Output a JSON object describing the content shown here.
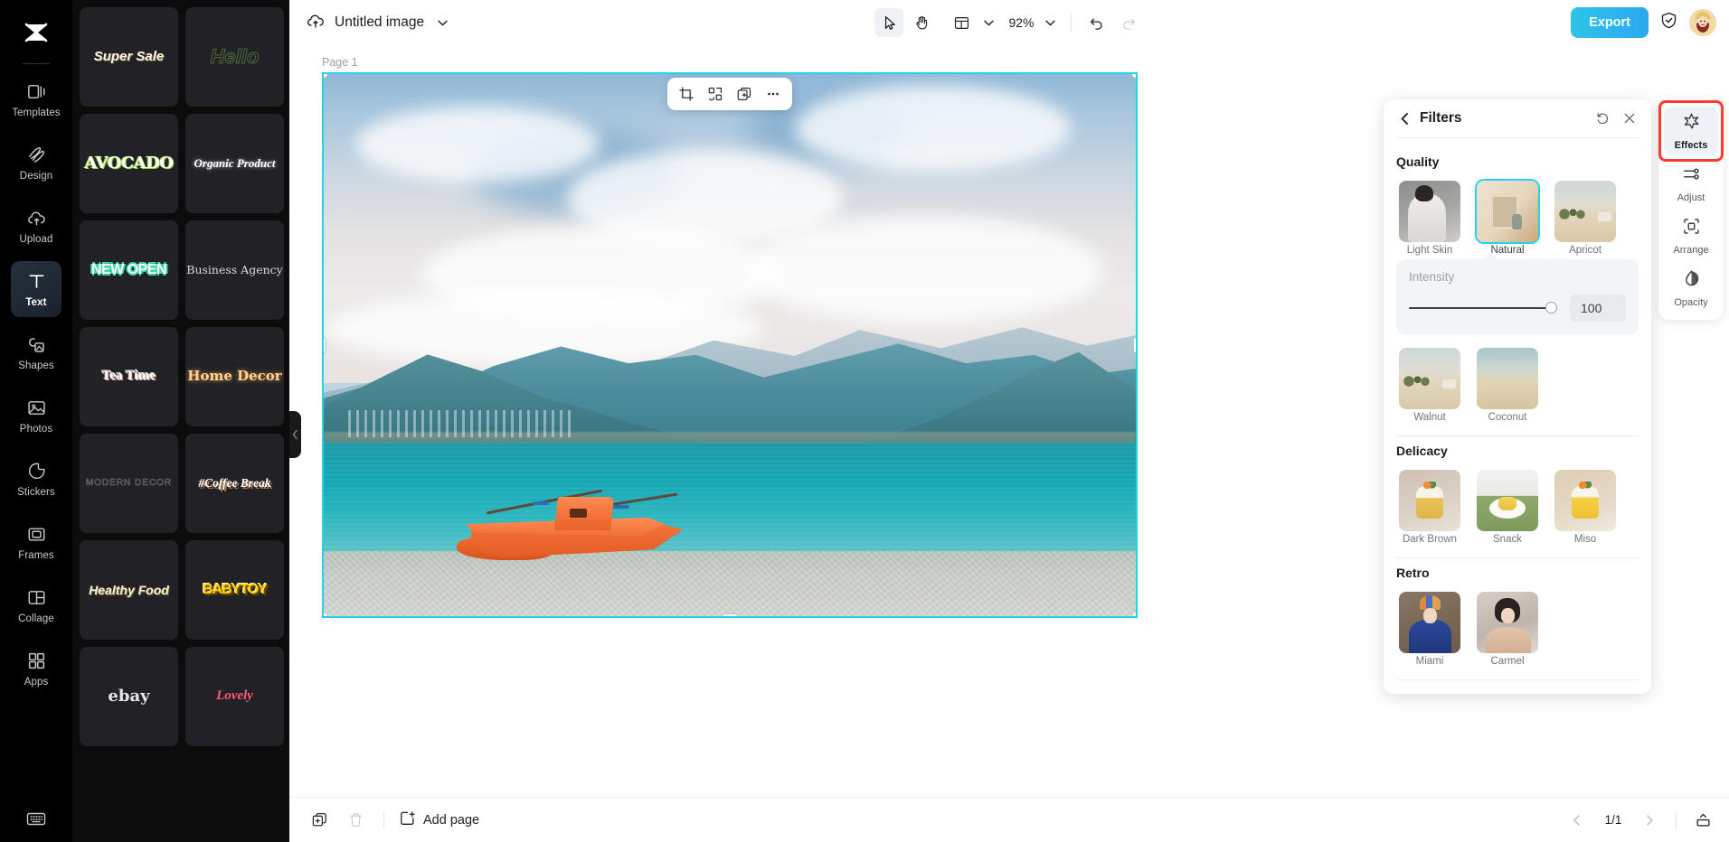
{
  "app": {
    "brand": "capcut-logo",
    "accent": "#22d3ee",
    "export_color": "#2fc4e8",
    "highlight_color": "#ff3b30"
  },
  "rail": {
    "items": [
      {
        "label": "Templates",
        "icon": "templates-icon",
        "active": false
      },
      {
        "label": "Design",
        "icon": "design-icon",
        "active": false
      },
      {
        "label": "Upload",
        "icon": "upload-icon",
        "active": false
      },
      {
        "label": "Text",
        "icon": "text-icon",
        "active": true
      },
      {
        "label": "Shapes",
        "icon": "shapes-icon",
        "active": false
      },
      {
        "label": "Photos",
        "icon": "photos-icon",
        "active": false
      },
      {
        "label": "Stickers",
        "icon": "stickers-icon",
        "active": false
      },
      {
        "label": "Frames",
        "icon": "frames-icon",
        "active": false
      },
      {
        "label": "Collage",
        "icon": "collage-icon",
        "active": false
      },
      {
        "label": "Apps",
        "icon": "apps-icon",
        "active": false
      }
    ],
    "bottom_icon": "keyboard-icon"
  },
  "templates": {
    "cards": [
      {
        "text": "Super Sale",
        "style": "t-super"
      },
      {
        "text": "Hello",
        "style": "t-hello"
      },
      {
        "text": "AVOCADO",
        "style": "t-avocado"
      },
      {
        "text": "Organic Product",
        "style": "t-organic"
      },
      {
        "text": "NEW OPEN",
        "style": "t-newopen"
      },
      {
        "text": "Business Agency",
        "style": "t-business"
      },
      {
        "text": "Tea Time",
        "style": "t-tea"
      },
      {
        "text": "Home Decor",
        "style": "t-home"
      },
      {
        "text": "MODERN DECOR",
        "style": "t-modern"
      },
      {
        "text": "#Coffee Break",
        "style": "t-coffee"
      },
      {
        "text": "Healthy Food",
        "style": "t-healthy"
      },
      {
        "text": "BABYTOY",
        "style": "t-baby"
      },
      {
        "text": "ebay",
        "style": "t-ebay"
      },
      {
        "text": "Lovely",
        "style": "t-lovely"
      }
    ]
  },
  "topbar": {
    "cloud_icon": "cloud-upload-icon",
    "title": "Untitled image",
    "title_chevron": "chevron-down-icon",
    "tools": [
      {
        "name": "select-tool",
        "icon": "cursor-arrow-icon",
        "selected": true
      },
      {
        "name": "hand-tool",
        "icon": "hand-icon",
        "selected": false
      }
    ],
    "layout_icon": "layout-panel-icon",
    "zoom": "92%",
    "undo_icon": "undo-icon",
    "redo_icon": "redo-icon",
    "export_label": "Export",
    "shield_icon": "shield-check-icon",
    "avatar": "user-avatar"
  },
  "canvas": {
    "page_label": "Page 1",
    "float_toolbar": [
      {
        "name": "crop-button",
        "icon": "crop-icon"
      },
      {
        "name": "remove-bg-button",
        "icon": "remove-background-icon"
      },
      {
        "name": "duplicate-button",
        "icon": "add-copy-icon"
      },
      {
        "name": "more-button",
        "icon": "ellipsis-icon"
      }
    ],
    "image_alt": "orange-catamaran-boat-on-lake-shore-with-mountains"
  },
  "filters": {
    "back_icon": "chevron-left-icon",
    "title": "Filters",
    "reset_icon": "reset-icon",
    "close_icon": "close-icon",
    "sections": [
      {
        "title": "Quality",
        "items": [
          {
            "label": "Light Skin",
            "thumb": "th-lightskin",
            "selected": false
          },
          {
            "label": "Natural",
            "thumb": "th-natural",
            "selected": true
          },
          {
            "label": "Apricot",
            "thumb": "th-desert",
            "selected": false
          },
          {
            "label": "Walnut",
            "thumb": "th-desert",
            "selected": false
          },
          {
            "label": "Coconut",
            "thumb": "th-desert2",
            "selected": false
          }
        ]
      },
      {
        "title": "Delicacy",
        "items": [
          {
            "label": "Dark Brown",
            "thumb": "th-cake",
            "selected": false
          },
          {
            "label": "Snack",
            "thumb": "th-snack",
            "selected": false
          },
          {
            "label": "Miso",
            "thumb": "th-miso",
            "selected": false
          }
        ]
      },
      {
        "title": "Retro",
        "items": [
          {
            "label": "Miami",
            "thumb": "th-miami",
            "selected": false
          },
          {
            "label": "Carmel",
            "thumb": "th-carmel",
            "selected": false
          }
        ]
      }
    ],
    "intensity": {
      "label": "Intensity",
      "value": "100",
      "percent": 100
    }
  },
  "right_rail": {
    "items": [
      {
        "label": "Effects",
        "icon": "sparkle-icon",
        "active": true,
        "highlighted": true
      },
      {
        "label": "Adjust",
        "icon": "sliders-icon",
        "active": false,
        "highlighted": false
      },
      {
        "label": "Arrange",
        "icon": "arrange-icon",
        "active": false,
        "highlighted": false
      },
      {
        "label": "Opacity",
        "icon": "opacity-drop-icon",
        "active": false,
        "highlighted": false
      }
    ]
  },
  "bottombar": {
    "duplicate_page_icon": "duplicate-page-icon",
    "delete_page_icon": "trash-icon",
    "add_page_icon": "add-page-icon",
    "add_page_label": "Add page",
    "prev_icon": "chevron-left-icon",
    "pages": "1/1",
    "next_icon": "chevron-right-icon",
    "collapse_icon": "collapse-panel-icon"
  }
}
